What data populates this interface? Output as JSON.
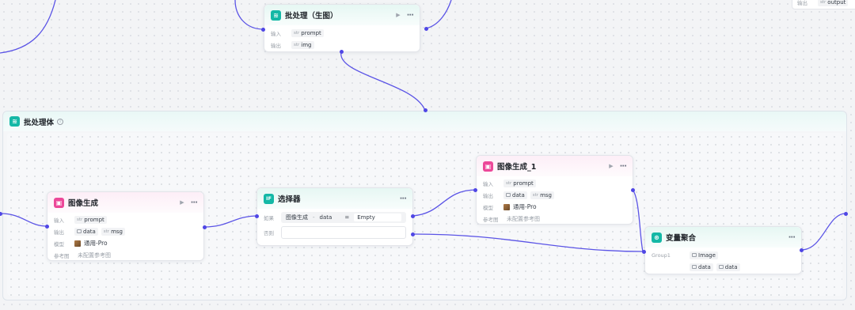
{
  "colors": {
    "wire": "#4f46e5",
    "accent_green": "#14b8a6",
    "accent_pink": "#ec4899"
  },
  "top_stub": {
    "label": "输出",
    "type": "str",
    "value": "output"
  },
  "batch_node": {
    "title": "批处理（生图）",
    "input_label": "输入",
    "input_type": "str",
    "input_value": "prompt",
    "output_label": "输出",
    "output_type": "str",
    "output_value": "img"
  },
  "container": {
    "title": "批处理体",
    "info_icon": "i"
  },
  "image_node": {
    "title": "图像生成",
    "input_label": "输入",
    "input_type": "str",
    "input_value": "prompt",
    "output_label": "输出",
    "output_1": "data",
    "output_2_type": "str",
    "output_2": "msg",
    "model_label": "模型",
    "model_value": "通用-Pro",
    "ref_label": "参考图",
    "ref_value": "未配置参考图"
  },
  "selector_node": {
    "title": "选择器",
    "icon_text": "IF",
    "if_label": "如果",
    "cond_source": "图像生成",
    "cond_sep": "-",
    "cond_field": "data",
    "cond_op": "=",
    "cond_value": "Empty",
    "else_label": "否则"
  },
  "image_node_1": {
    "title": "图像生成_1",
    "input_label": "输入",
    "input_type": "str",
    "input_value": "prompt",
    "output_label": "输出",
    "output_1": "data",
    "output_2_type": "str",
    "output_2": "msg",
    "model_label": "模型",
    "model_value": "通用-Pro",
    "ref_label": "参考图",
    "ref_value": "未配置参考图"
  },
  "merge_node": {
    "title": "变量聚合",
    "group_label": "Group1",
    "item_1": "Image",
    "item_2": "data",
    "item_3": "data"
  }
}
